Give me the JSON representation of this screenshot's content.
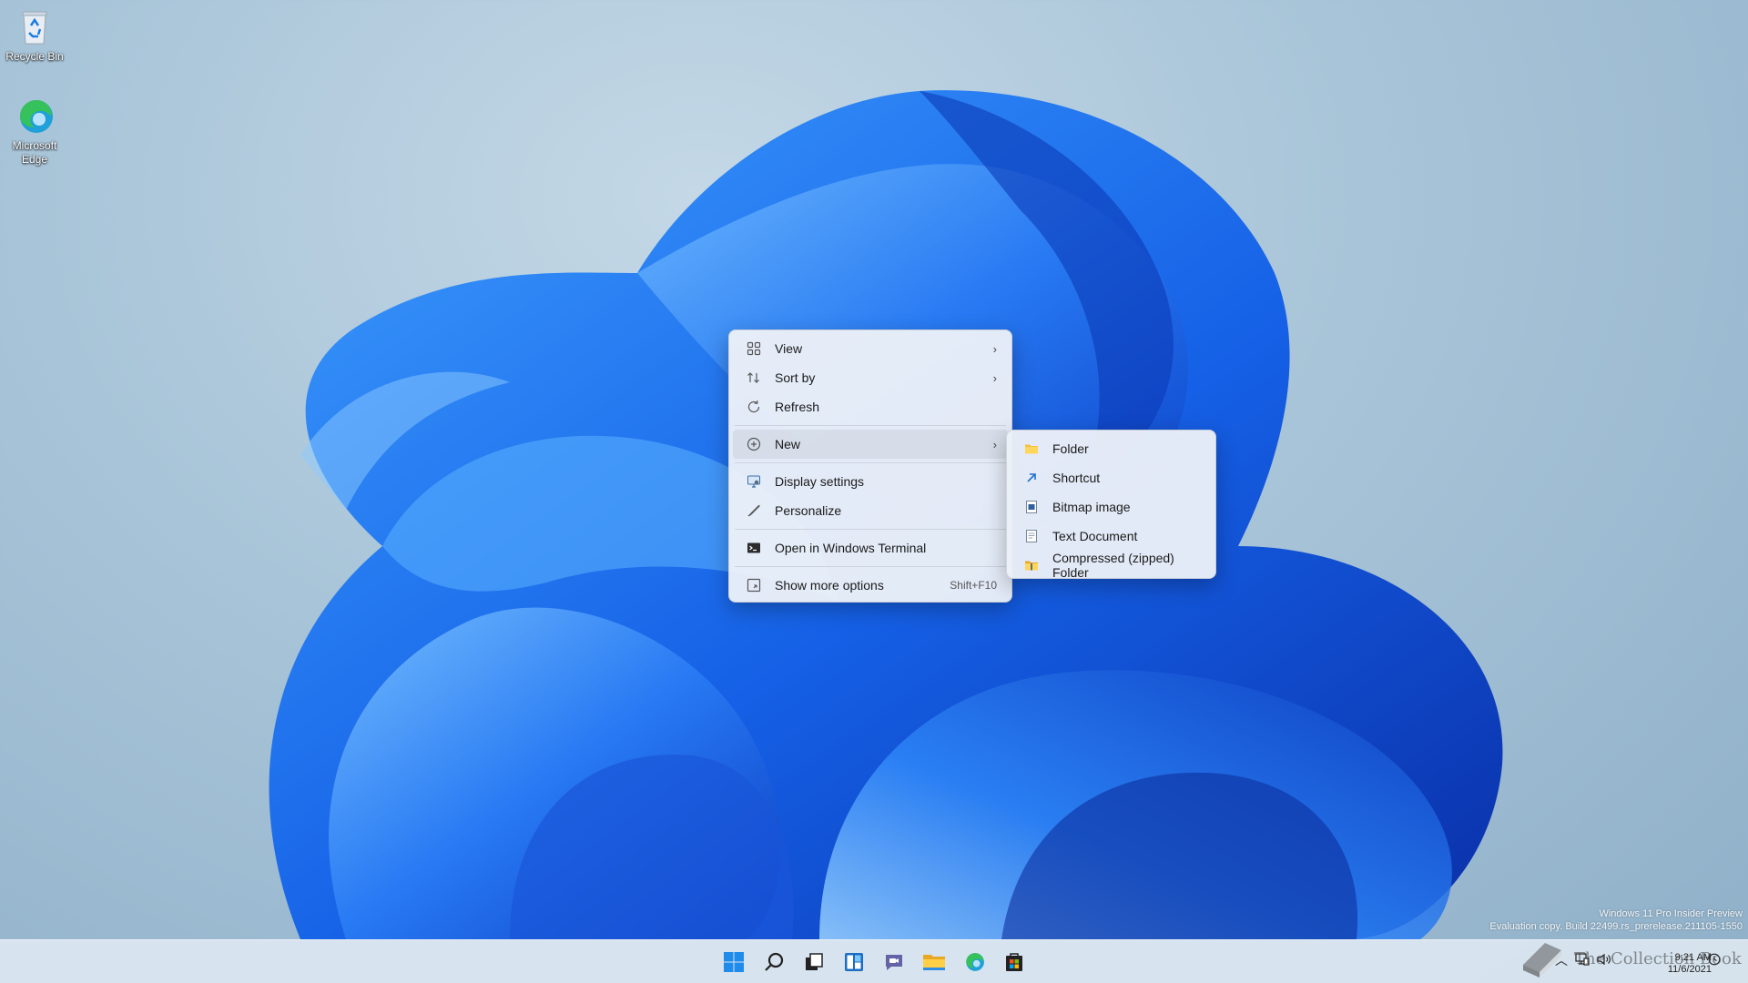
{
  "desktop": {
    "icons": [
      {
        "label": "Recycle Bin",
        "icon": "recycle-bin-icon"
      },
      {
        "label": "Microsoft Edge",
        "icon": "edge-icon"
      }
    ]
  },
  "context_menu": {
    "items": [
      {
        "label": "View",
        "icon": "grid-view-icon",
        "has_submenu": true
      },
      {
        "label": "Sort by",
        "icon": "sort-icon",
        "has_submenu": true
      },
      {
        "label": "Refresh",
        "icon": "refresh-icon"
      },
      {
        "label": "New",
        "icon": "plus-circle-icon",
        "has_submenu": true,
        "highlighted": true
      },
      {
        "label": "Display settings",
        "icon": "display-icon"
      },
      {
        "label": "Personalize",
        "icon": "brush-icon"
      },
      {
        "label": "Open in Windows Terminal",
        "icon": "terminal-icon"
      },
      {
        "label": "Show more options",
        "icon": "more-options-icon",
        "shortcut": "Shift+F10"
      }
    ]
  },
  "new_submenu": {
    "items": [
      {
        "label": "Folder",
        "icon": "folder-icon"
      },
      {
        "label": "Shortcut",
        "icon": "shortcut-icon"
      },
      {
        "label": "Bitmap image",
        "icon": "bitmap-icon"
      },
      {
        "label": "Text Document",
        "icon": "text-document-icon"
      },
      {
        "label": "Compressed (zipped) Folder",
        "icon": "zip-folder-icon"
      }
    ]
  },
  "taskbar": {
    "apps": [
      "start-icon",
      "search-icon",
      "task-view-icon",
      "widgets-icon",
      "chat-icon",
      "file-explorer-icon",
      "edge-icon",
      "store-icon"
    ],
    "tray": [
      "chevron-up-icon",
      "network-icon",
      "volume-icon"
    ],
    "time": "9:21 AM",
    "date": "11/6/2021"
  },
  "watermark": {
    "line1": "Windows 11 Pro Insider Preview",
    "line2": "Evaluation copy. Build 22499.rs_prerelease.211105-1550"
  },
  "brand": {
    "text": "The Collection Book"
  },
  "colors": {
    "accent": "#0067c0",
    "menu_bg": "#ecf0f8",
    "bloom": "#1a6cf0"
  }
}
